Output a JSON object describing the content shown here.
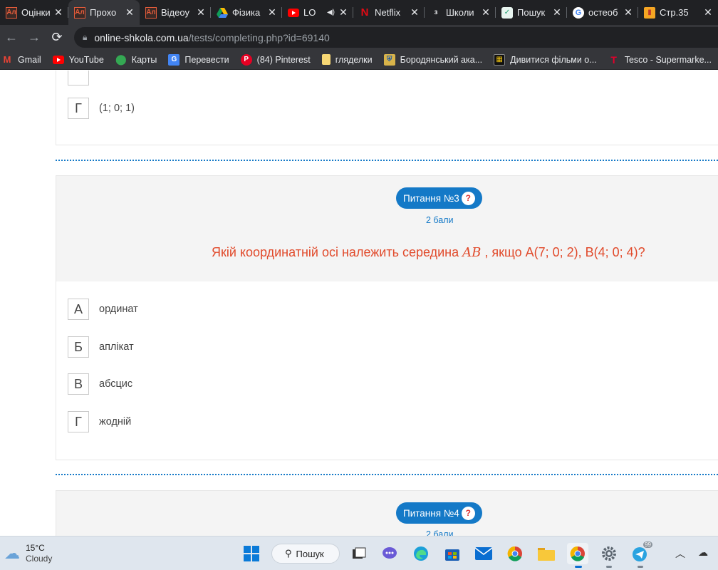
{
  "tabs": [
    {
      "title": "Оцінки",
      "icon": "online-shkola-icon",
      "active": false
    },
    {
      "title": "Прохо",
      "icon": "online-shkola-icon",
      "active": true
    },
    {
      "title": "Відеоу",
      "icon": "online-shkola-icon",
      "active": false
    },
    {
      "title": "Фізика",
      "icon": "google-drive-icon",
      "active": false
    },
    {
      "title": "LO",
      "icon": "youtube-icon",
      "active": false,
      "audio": true
    },
    {
      "title": "Netflix",
      "icon": "netflix-icon",
      "active": false
    },
    {
      "title": "Школи",
      "icon": "shkola-icon",
      "active": false
    },
    {
      "title": "Пошук",
      "icon": "check-icon",
      "active": false
    },
    {
      "title": "остеоб",
      "icon": "google-icon",
      "active": false
    },
    {
      "title": "Стр.35",
      "icon": "book-icon",
      "active": false
    }
  ],
  "url": {
    "host": "online-shkola.com.ua",
    "path": "/tests/completing.php?id=69140"
  },
  "bookmarks": [
    {
      "label": "Gmail",
      "icon": "gmail-icon"
    },
    {
      "label": "YouTube",
      "icon": "youtube-icon"
    },
    {
      "label": "Карты",
      "icon": "maps-icon"
    },
    {
      "label": "Перевести",
      "icon": "translate-icon"
    },
    {
      "label": "(84) Pinterest",
      "icon": "pinterest-icon"
    },
    {
      "label": "гляделки",
      "icon": "folder-icon"
    },
    {
      "label": "Бородянський ака...",
      "icon": "crest-icon"
    },
    {
      "label": "Дивитися фільми о...",
      "icon": "film-icon"
    },
    {
      "label": "Tesco - Supermarke...",
      "icon": "tesco-icon"
    }
  ],
  "prev_question": {
    "option_g": {
      "letter": "Г",
      "text": "(1; 0; 1)"
    }
  },
  "question3": {
    "badge": "Питання №3",
    "help": "?",
    "points": "2 бали",
    "text_before": "Якій координатній осі належить середина ",
    "text_var": "AB",
    "text_after": " , якщо A(7; 0; 2), B(4; 0; 4)?",
    "options": [
      {
        "letter": "А",
        "text": "ординат"
      },
      {
        "letter": "Б",
        "text": "аплікат"
      },
      {
        "letter": "В",
        "text": "абсцис"
      },
      {
        "letter": "Г",
        "text": "жодній"
      }
    ]
  },
  "question4": {
    "badge": "Питання №4",
    "help": "?",
    "points": "2 бали"
  },
  "taskbar": {
    "temp": "15°C",
    "condition": "Cloudy",
    "search_label": "Пошук",
    "telegram_badge": "99"
  },
  "colors": {
    "accent": "#1479c7",
    "question_text": "#e14a2b"
  }
}
